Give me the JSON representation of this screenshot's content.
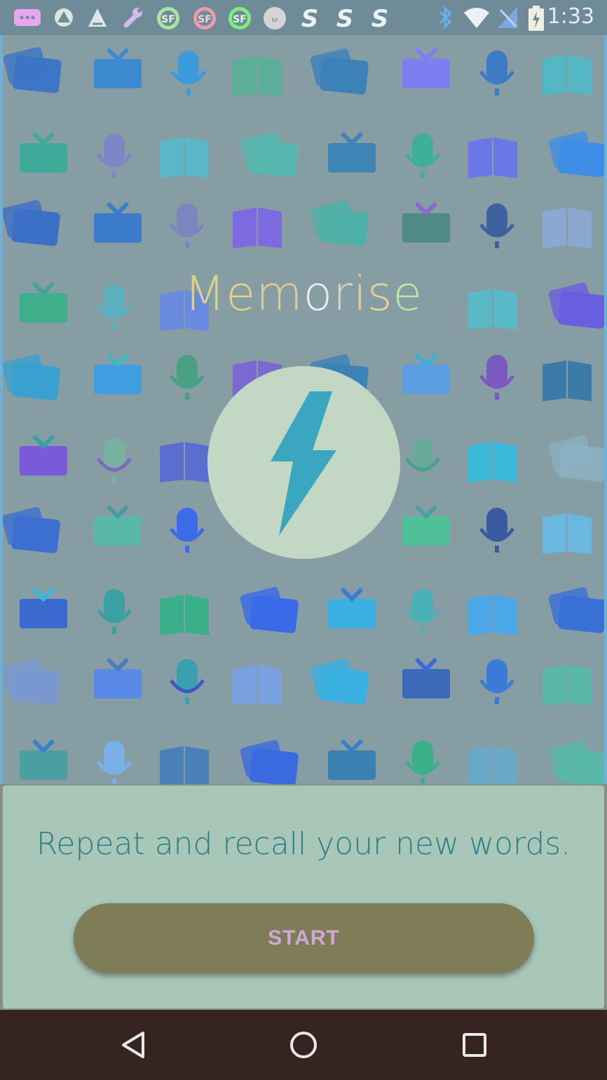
{
  "status_bar": {
    "time": "1:33",
    "notification_icons": [
      "messages-icon",
      "app-icon",
      "app-icon",
      "wrench-icon",
      "sf-icon",
      "sf-icon",
      "sf-icon",
      "app-icon",
      "s-icon",
      "s-icon",
      "s-icon"
    ],
    "system_icons": [
      "bluetooth-icon",
      "wifi-icon",
      "no-signal-icon",
      "battery-charging-icon"
    ]
  },
  "app": {
    "title": "Memorise",
    "tagline": "Repeat and recall your new words.",
    "start_label": "START",
    "icon": "lightning-bolt-icon"
  },
  "nav_bar": {
    "buttons": [
      "back-icon",
      "home-icon",
      "recent-apps-icon"
    ]
  },
  "colors": {
    "background": "#879da4",
    "panel": "#a9c7b9",
    "start_button": "#7f7c58",
    "start_text": "#cfa8d6",
    "accent": "#3aa6c0"
  }
}
